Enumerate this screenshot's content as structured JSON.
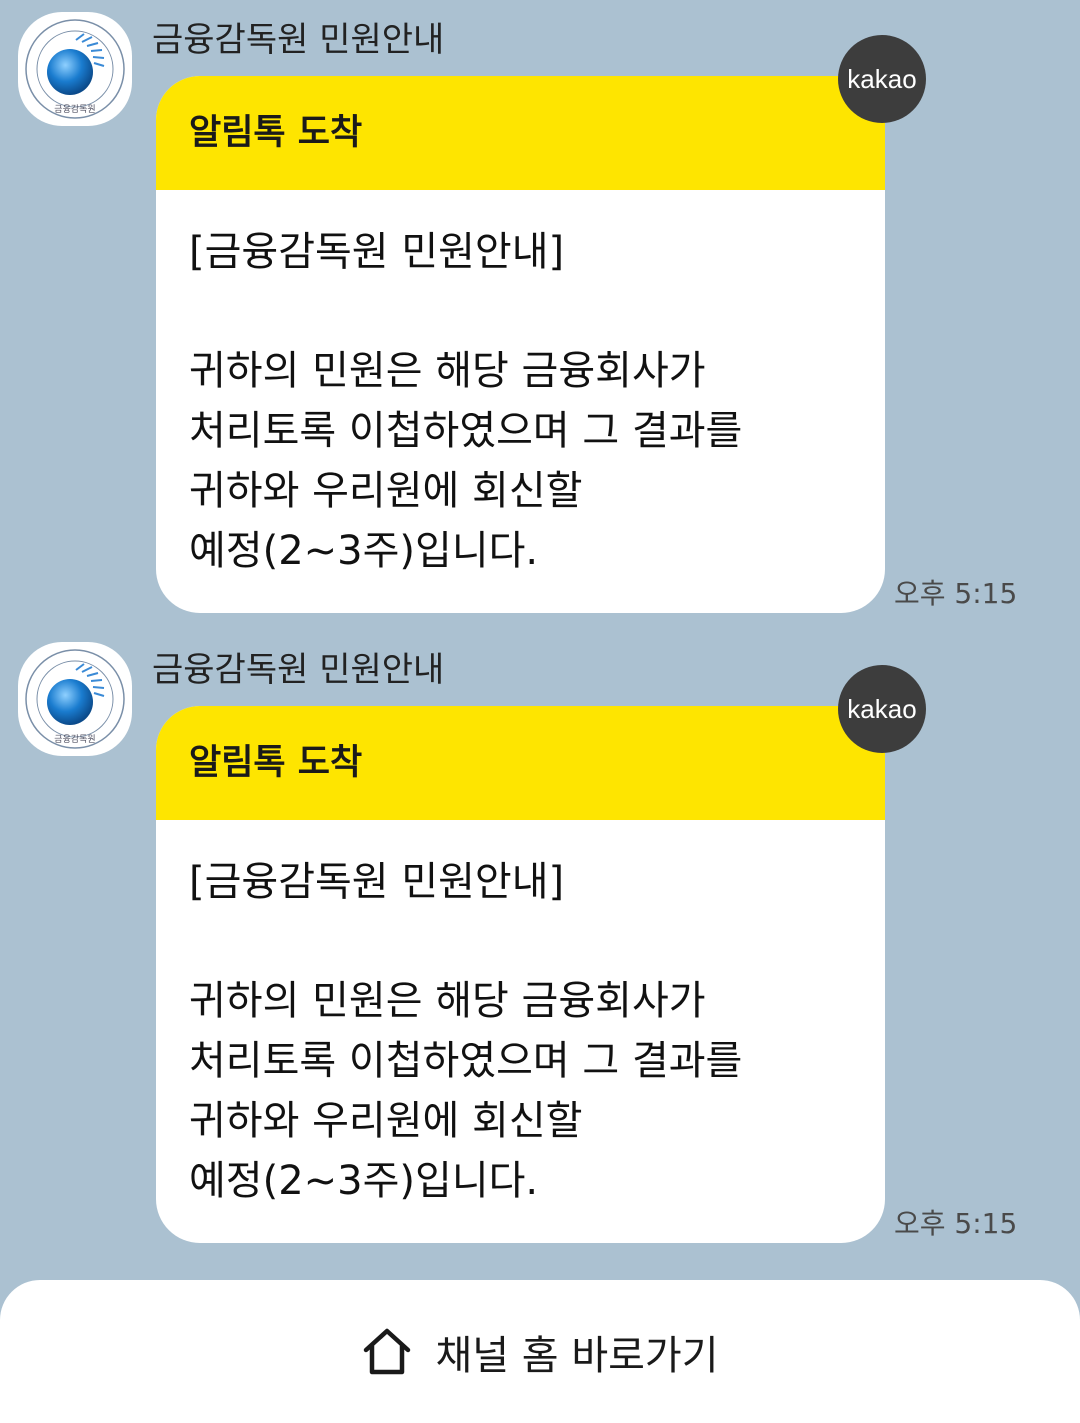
{
  "channel": {
    "name": "금융감독원 민원안내",
    "logo_text": "금융감독원"
  },
  "messages": [
    {
      "header": "알림톡 도착",
      "body": {
        "title": "[금융감독원 민원안내]",
        "lines": [
          "귀하의 민원은 해당 금융회사가",
          "처리토록 이첩하였으며 그 결과를",
          "귀하와 우리원에 회신할",
          "예정(2~3주)입니다."
        ]
      },
      "badge": "kakao",
      "time": "오후 5:15"
    },
    {
      "header": "알림톡 도착",
      "body": {
        "title": "[금융감독원 민원안내]",
        "lines": [
          "귀하의 민원은 해당 금융회사가",
          "처리토록 이첩하였으며 그 결과를",
          "귀하와 우리원에 회신할",
          "예정(2~3주)입니다."
        ]
      },
      "badge": "kakao",
      "time": "오후 5:15"
    }
  ],
  "bottom": {
    "home_label": "채널 홈 바로가기",
    "home_icon": "home-icon"
  },
  "colors": {
    "background": "#abc1d1",
    "header_yellow": "#fee500",
    "badge": "#3d3d3d"
  }
}
